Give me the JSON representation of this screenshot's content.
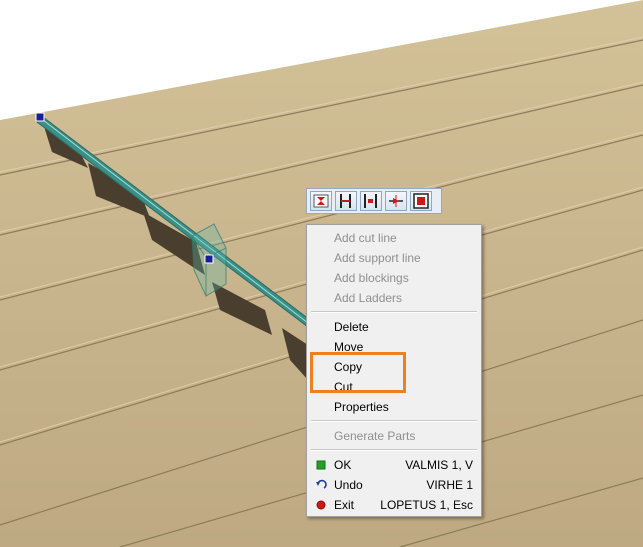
{
  "toolbar": {
    "buttons": [
      {
        "icon": "split-joist-icon"
      },
      {
        "icon": "support-line-icon"
      },
      {
        "icon": "blocking-icon"
      },
      {
        "icon": "ladder-icon"
      },
      {
        "icon": "frame-select-icon"
      }
    ]
  },
  "menu": {
    "add_cut_line": "Add cut line",
    "add_support_line": "Add support line",
    "add_blockings": "Add blockings",
    "add_ladders": "Add Ladders",
    "delete": "Delete",
    "move": "Move",
    "copy": "Copy",
    "cut": "Cut",
    "properties": "Properties",
    "generate_parts": "Generate Parts",
    "ok": "OK",
    "ok_shortcut": "VALMIS 1, V",
    "undo": "Undo",
    "undo_shortcut": "VIRHE 1",
    "exit": "Exit",
    "exit_shortcut": "LOPETUS 1, Esc"
  },
  "colors": {
    "deck_wood": "#c9b58c",
    "highlight": "#f07f1e",
    "ok_icon": "#22a022",
    "exit_icon": "#d01818",
    "undo_icon": "#1a3fa0",
    "beam": "#3c8f86"
  }
}
